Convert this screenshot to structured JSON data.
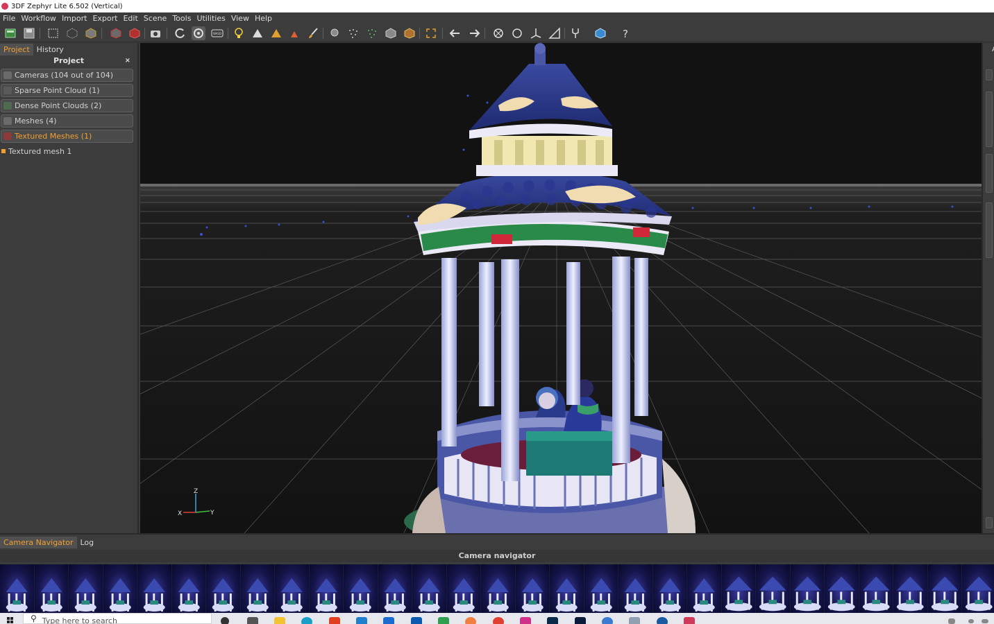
{
  "window": {
    "title": "3DF Zephyr Lite 6.502 (Vertical)"
  },
  "menu": [
    "File",
    "Workflow",
    "Import",
    "Export",
    "Edit",
    "Scene",
    "Tools",
    "Utilities",
    "View",
    "Help"
  ],
  "toolbar": {
    "icons": [
      "new-project-icon",
      "save-icon",
      "selection-rect-icon",
      "points-cube-icon",
      "mesh-cube-icon",
      "cube-red-icon",
      "texture-cube-icon",
      "camera-icon",
      "orbit-icon",
      "orbit-active-icon",
      "wasd-icon",
      "bulb-icon",
      "triangles-icon",
      "triangles-color-icon",
      "triangle-small-icon",
      "brush-icon",
      "lasso-icon",
      "dots-icon",
      "dots-green-icon",
      "gray-cube-icon",
      "color-cube-icon",
      "frame-icon",
      "undo-icon",
      "redo-icon",
      "rotate-icon",
      "circle-icon",
      "transform-icon",
      "ruler-icon",
      "fork-icon",
      "blue-cube-icon",
      "help-icon"
    ],
    "wasd_label": "WASD",
    "help_label": "?"
  },
  "left_panel": {
    "tabs": [
      {
        "label": "Project",
        "active": true
      },
      {
        "label": "History",
        "active": false
      }
    ],
    "header": "Project",
    "close_label": "×",
    "items": [
      {
        "label": "Cameras (104 out of 104)",
        "icon": "cameras-icon",
        "active": false
      },
      {
        "label": "Sparse Point Cloud (1)",
        "icon": "sparse-cloud-icon",
        "active": false
      },
      {
        "label": "Dense Point Clouds (2)",
        "icon": "dense-cloud-icon",
        "active": false
      },
      {
        "label": "Meshes (4)",
        "icon": "meshes-icon",
        "active": false
      },
      {
        "label": "Textured Meshes (1)",
        "icon": "textured-meshes-icon",
        "active": true
      }
    ],
    "children": [
      {
        "label": "Textured mesh 1"
      }
    ]
  },
  "viewport": {
    "axis": {
      "x": "X",
      "y": "Y",
      "z": "Z"
    }
  },
  "right_strip": {
    "label": "A"
  },
  "bottom_panel": {
    "tabs": [
      {
        "label": "Camera Navigator",
        "active": true
      },
      {
        "label": "Log",
        "active": false
      }
    ],
    "title": "Camera navigator",
    "thumbnail_count": 29
  },
  "taskbar": {
    "search_placeholder": "Type here to search"
  },
  "colors": {
    "accent": "#f0a030",
    "panel": "#3c3c3c",
    "viewport_bg": "#121212"
  }
}
